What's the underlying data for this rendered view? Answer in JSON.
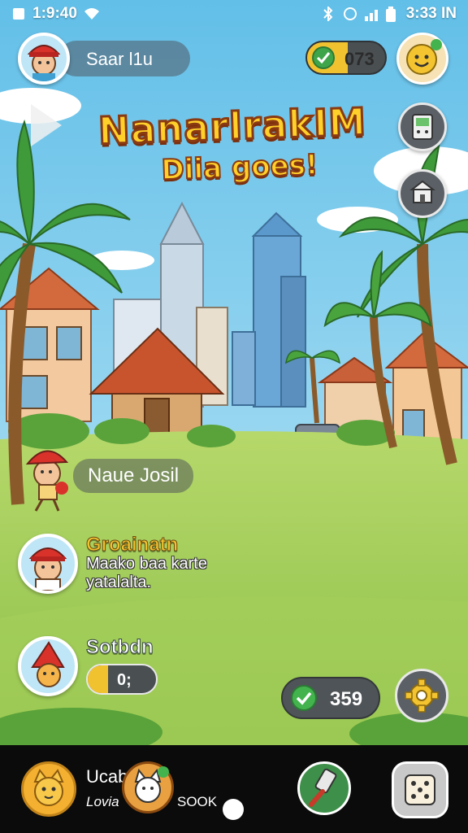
{
  "status_bar": {
    "time_left": "1:9:40",
    "time_right": "3:33 IN"
  },
  "player": {
    "name": "Saar l1u"
  },
  "coins": {
    "value": "073",
    "fill_fraction": 0.52
  },
  "title": {
    "main": "NanarlrakIM",
    "sub": "Diia goes!"
  },
  "entries": [
    {
      "name": "Naue Josil"
    },
    {
      "title": "Groainatn",
      "subtitle_line1": "Maako baa karte",
      "subtitle_line2": "yatalalta."
    },
    {
      "title": "Sotbdn",
      "progress_text": "0;",
      "progress_fraction": 0.3
    }
  ],
  "bonus": {
    "value": "359"
  },
  "bottom_nav": {
    "label_top": "Ucab",
    "label_left": "Lovia",
    "label_right": "SOOK"
  },
  "colors": {
    "accent_gold": "#f1c230",
    "check_green": "#43b34e",
    "panel_dark": "#4a4f52"
  }
}
